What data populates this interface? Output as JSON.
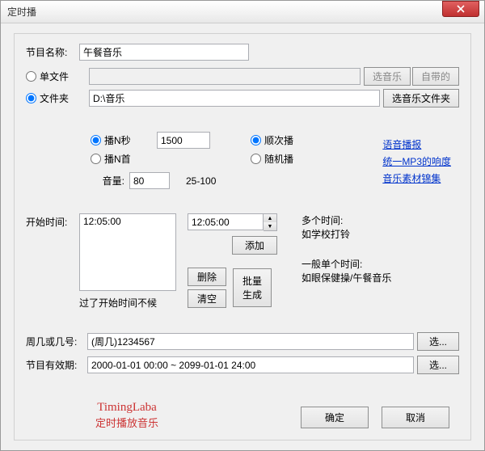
{
  "window": {
    "title": "定时播"
  },
  "program": {
    "name_label": "节目名称:",
    "name_value": "午餐音乐"
  },
  "source": {
    "single_file_label": "单文件",
    "folder_label": "文件夹",
    "single_file_path": "",
    "folder_path": "D:\\音乐",
    "select_music_btn": "选音乐",
    "builtin_btn": "自带的",
    "select_folder_btn": "选音乐文件夹"
  },
  "links": {
    "voice": "语音播报",
    "normalize": "统一MP3的响度",
    "materials": "音乐素材锦集"
  },
  "play": {
    "n_seconds_label": "播N秒",
    "n_songs_label": "播N首",
    "n_value": "1500",
    "sequential_label": "顺次播",
    "random_label": "随机播",
    "volume_label": "音量:",
    "volume_value": "80",
    "volume_range": "25-100"
  },
  "time": {
    "start_label": "开始时间:",
    "list_value": "12:05:00",
    "spinner_value": "12:05:00",
    "add_btn": "添加",
    "delete_btn": "删除",
    "clear_btn": "清空",
    "batch_btn": "批量\n生成",
    "note_missed": "过了开始时间不候",
    "help_multi_1": "多个时间:",
    "help_multi_2": "如学校打铃",
    "help_single_1": "一般单个时间:",
    "help_single_2": "如眼保健操/午餐音乐"
  },
  "schedule": {
    "weekday_label": "周几或几号:",
    "weekday_value": "(周几)1234567",
    "validity_label": "节目有效期:",
    "validity_value": "2000-01-01 00:00 ~ 2099-01-01 24:00",
    "select_btn": "选..."
  },
  "brand": {
    "line1": "TimingLaba",
    "line2": "定时播放音乐"
  },
  "buttons": {
    "ok": "确定",
    "cancel": "取消"
  }
}
